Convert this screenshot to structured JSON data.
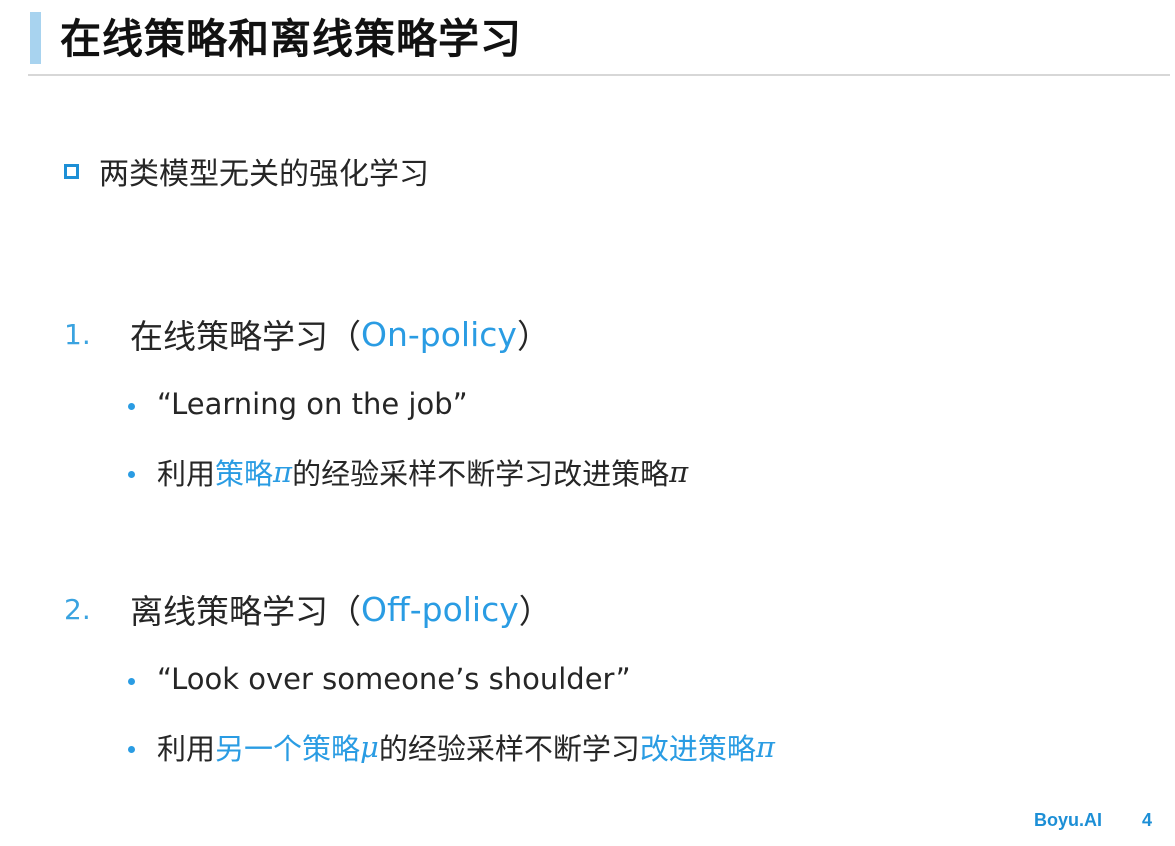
{
  "slide": {
    "title": "在线策略和离线策略学习",
    "section_heading": "两类模型无关的强化学习",
    "items": [
      {
        "number": "1.",
        "label": "在线策略学习（",
        "term": "On-policy",
        "close": "）",
        "bullets": [
          {
            "text": "“Learning on the job”"
          },
          {
            "pre": "利用",
            "accent1": "策略",
            "sym1": "π",
            "mid": "的经验采样不断学习改进策略",
            "sym2": "π"
          }
        ]
      },
      {
        "number": "2.",
        "label": "离线策略学习（",
        "term": "Off-policy",
        "close": "）",
        "bullets": [
          {
            "text": "“Look over someone’s shoulder”"
          },
          {
            "pre": "利用",
            "accent1": "另一个策略",
            "sym1": "μ",
            "mid": "的经验采样不断学习",
            "accent2": "改进策略",
            "sym2": "π"
          }
        ]
      }
    ]
  },
  "footer": {
    "brand": "Boyu.AI",
    "page_number": "4"
  },
  "colors": {
    "accent": "#2a9ce3",
    "title_bar": "#a8d3ef",
    "text": "#262626"
  }
}
